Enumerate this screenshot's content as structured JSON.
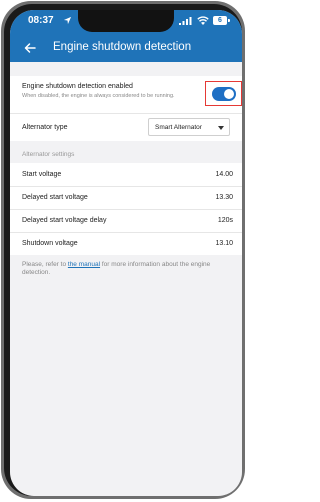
{
  "status_bar": {
    "time": "08:37",
    "battery": "6"
  },
  "app_bar": {
    "title": "Engine shutdown detection"
  },
  "engine_detection": {
    "title": "Engine shutdown detection enabled",
    "description": "When disabled, the engine is always considered to be running.",
    "enabled": true
  },
  "alternator": {
    "label": "Alternator type",
    "value": "Smart Alternator"
  },
  "alternator_settings": {
    "header": "Alternator settings",
    "rows": [
      {
        "label": "Start voltage",
        "value": "14.00"
      },
      {
        "label": "Delayed start voltage",
        "value": "13.30"
      },
      {
        "label": "Delayed start voltage delay",
        "value": "120s"
      },
      {
        "label": "Shutdown voltage",
        "value": "13.10"
      }
    ]
  },
  "footer": {
    "prefix": "Please, refer to ",
    "link": "the manual",
    "suffix": " for more information about the engine detection."
  },
  "colors": {
    "accent": "#1f73b8",
    "toggle_on": "#1e6fc4",
    "highlight": "#e53935"
  }
}
